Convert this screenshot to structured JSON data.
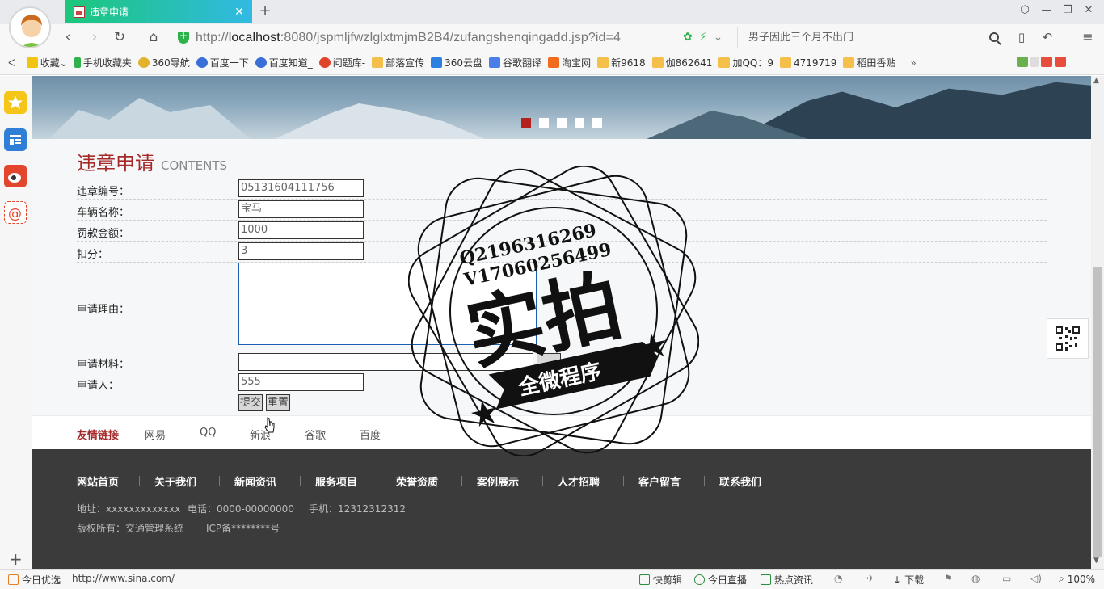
{
  "browser": {
    "tab_title": "违章申请",
    "url_host": "localhost",
    "url_rest": ":8080/jspmljfwzlglxtmjmB2B4/zufangshenqingadd.jsp?id=4",
    "url_scheme": "http://",
    "search_text": "男子因此三个月不出门",
    "bookmarks": [
      "收藏",
      "手机收藏夹",
      "360导航",
      "百度一下",
      "百度知道_",
      "问题库-",
      "部落宣传",
      "360云盘",
      "谷歌翻译",
      "淘宝网",
      "新9618",
      "伽862641",
      "加QQ：9",
      "4719719",
      "稻田香贴"
    ]
  },
  "page": {
    "heading": "违章申请",
    "heading_sub": "CONTENTS",
    "form": {
      "fields": [
        {
          "label": "违章编号：",
          "value": "05131604111756"
        },
        {
          "label": "车辆名称：",
          "value": "宝马"
        },
        {
          "label": "罚款金额：",
          "value": "1000"
        },
        {
          "label": "扣分：",
          "value": "3"
        }
      ],
      "reason_label": "申请理由：",
      "material_label": "申请材料：",
      "applicant_label": "申请人：",
      "applicant_value": "555",
      "submit_label": "提交",
      "reset_label": "重置"
    },
    "links": {
      "lead": "友情链接",
      "items": [
        "网易",
        "QQ",
        "新浪",
        "谷歌",
        "百度"
      ]
    },
    "footer": {
      "nav": [
        "网站首页",
        "关于我们",
        "新闻资讯",
        "服务项目",
        "荣誉资质",
        "案例展示",
        "人才招聘",
        "客户留言",
        "联系我们"
      ],
      "address": "地址：xxxxxxxxxxxxx",
      "phone": "电话：0000-00000000",
      "mobile": "手机：12312312312",
      "copyright": "版权所有：交通管理系统",
      "icp": "ICP备********号"
    }
  },
  "stamp": {
    "line1": "Q2196316269",
    "line2": "V17060256499",
    "big": "实拍",
    "ribbon": "全微程序"
  },
  "statusbar": {
    "left": "今日优选",
    "url": "http://www.sina.com/",
    "items": [
      "快剪辑",
      "今日直播",
      "热点资讯",
      "下载"
    ],
    "zoom": "100%"
  }
}
